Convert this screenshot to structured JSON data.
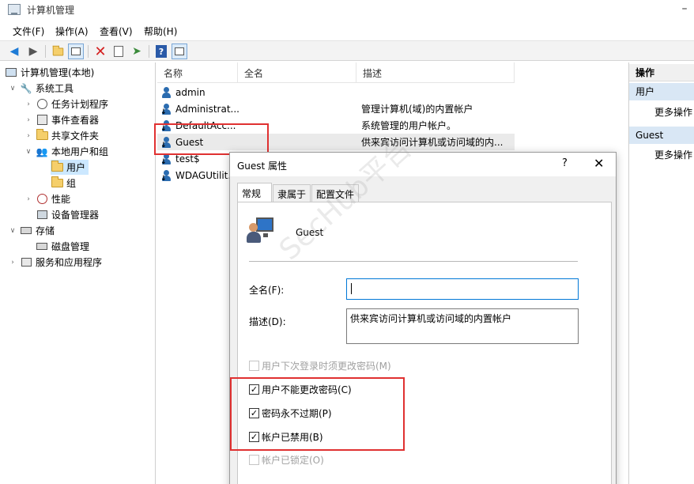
{
  "window": {
    "title": "计算机管理",
    "minimize_glyph": "–"
  },
  "menu": [
    "文件(F)",
    "操作(A)",
    "查看(V)",
    "帮助(H)"
  ],
  "toolbar": {
    "icons": [
      "back-arrow-icon",
      "forward-arrow-icon",
      "up-folder-icon",
      "show-hide-tree-icon",
      "delete-icon",
      "properties-icon",
      "export-list-icon",
      "help-icon",
      "show-action-pane-icon"
    ]
  },
  "tree": {
    "root": "计算机管理(本地)",
    "system_tools": "系统工具",
    "task_scheduler": "任务计划程序",
    "event_viewer": "事件查看器",
    "shared_folders": "共享文件夹",
    "local_users_groups": "本地用户和组",
    "users": "用户",
    "groups": "组",
    "performance": "性能",
    "device_manager": "设备管理器",
    "storage": "存储",
    "disk_management": "磁盘管理",
    "services_apps": "服务和应用程序"
  },
  "list": {
    "headers": {
      "name": "名称",
      "fullname": "全名",
      "description": "描述"
    },
    "rows": [
      {
        "name": "admin",
        "description": ""
      },
      {
        "name": "Administrat...",
        "description": "管理计算机(域)的内置帐户"
      },
      {
        "name": "DefaultAcc...",
        "description": "系统管理的用户帐户。"
      },
      {
        "name": "Guest",
        "description": "供来宾访问计算机或访问域的内..."
      },
      {
        "name": "test$",
        "description": ""
      },
      {
        "name": "WDAGUtilit...",
        "description": ""
      }
    ]
  },
  "actions": {
    "title": "操作",
    "section1": "用户",
    "section1_more": "更多操作",
    "section2": "Guest",
    "section2_more": "更多操作"
  },
  "dialog": {
    "title": "Guest 属性",
    "help": "?",
    "close": "✕",
    "tabs": [
      "常规",
      "隶属于",
      "配置文件"
    ],
    "username": "Guest",
    "fullname_label": "全名(F):",
    "fullname_value": "",
    "description_label": "描述(D):",
    "description_value": "供来宾访问计算机或访问域的内置帐户",
    "chk_must_change": "用户下次登录时须更改密码(M)",
    "chk_cannot_change": "用户不能更改密码(C)",
    "chk_never_expires": "密码永不过期(P)",
    "chk_disabled": "帐户已禁用(B)",
    "chk_locked": "帐户已锁定(O)",
    "check_mark": "✓"
  },
  "watermark": "SecHub平台",
  "colors": {
    "highlight_red": "#e03131",
    "selection_blue": "#cce8ff",
    "focus_blue": "#0078d7"
  }
}
